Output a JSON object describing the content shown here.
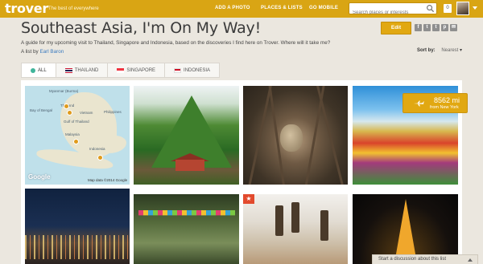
{
  "topbar": {
    "logo": "trover",
    "tagline": "The best of everywhere",
    "nav": [
      "ADD A PHOTO",
      "PLACES & LISTS",
      "GO MOBILE"
    ],
    "search_placeholder": "Search places or interests",
    "notifications": "0"
  },
  "header": {
    "title": "Southeast Asia, I'm On My Way!",
    "description": "A guide for my upcoming visit to Thailand, Singapore and Indonesia, based on the discoveries I find here on Trover. Where will it take me?",
    "byline_prefix": "A list by",
    "author": "Earl Baron",
    "edit_label": "Edit",
    "share_icons": [
      "facebook-icon",
      "twitter-icon",
      "tumblr-icon",
      "pinterest-icon",
      "email-icon"
    ],
    "sort_label": "Sort by:",
    "sort_value": "Nearest"
  },
  "tabs": [
    {
      "label": "ALL",
      "icon": "globe-icon",
      "active": true
    },
    {
      "label": "THAILAND",
      "icon": "thailand-flag-icon"
    },
    {
      "label": "SINGAPORE",
      "icon": "singapore-flag-icon"
    },
    {
      "label": "INDONESIA",
      "icon": "indonesia-flag-icon"
    }
  ],
  "map": {
    "labels": [
      "Myanmar (Burma)",
      "Bay of Bengal",
      "Thailand",
      "Vietnam",
      "Gulf of Thailand",
      "Philippines",
      "Malaysia",
      "Indonesia"
    ],
    "brand": "Google",
    "attribution": "Map data ©2014 Google"
  },
  "distance": {
    "value": "8562 mi",
    "from": "from New York"
  },
  "discussion_label": "Start a discussion about this list"
}
